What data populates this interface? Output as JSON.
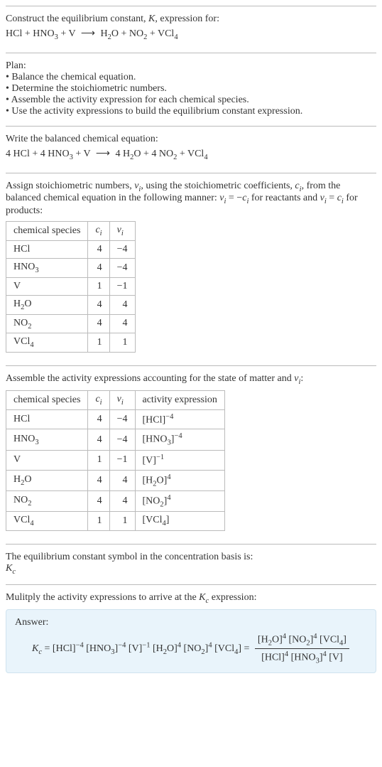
{
  "header": {
    "construct_prefix": "Construct the equilibrium constant, ",
    "K": "K",
    "construct_suffix": ", expression for:"
  },
  "unbalanced": {
    "lhs": [
      {
        "coef": "",
        "base": "HCl",
        "sub": ""
      },
      {
        "coef": "",
        "base": "HNO",
        "sub": "3"
      },
      {
        "coef": "",
        "base": "V",
        "sub": ""
      }
    ],
    "rhs": [
      {
        "coef": "",
        "base": "H",
        "sub": "2",
        "base2": "O"
      },
      {
        "coef": "",
        "base": "NO",
        "sub": "2"
      },
      {
        "coef": "",
        "base": "VCl",
        "sub": "4"
      }
    ],
    "arrow": "⟶",
    "plus": " + "
  },
  "plan": {
    "title": "Plan:",
    "items": [
      "Balance the chemical equation.",
      "Determine the stoichiometric numbers.",
      "Assemble the activity expression for each chemical species.",
      "Use the activity expressions to build the equilibrium constant expression."
    ],
    "bullet": "• "
  },
  "balanced_intro": "Write the balanced chemical equation:",
  "balanced": {
    "lhs": [
      {
        "coef": "4 ",
        "base": "HCl",
        "sub": ""
      },
      {
        "coef": "4 ",
        "base": "HNO",
        "sub": "3"
      },
      {
        "coef": "",
        "base": "V",
        "sub": ""
      }
    ],
    "rhs": [
      {
        "coef": "4 ",
        "base": "H",
        "sub": "2",
        "base2": "O"
      },
      {
        "coef": "4 ",
        "base": "NO",
        "sub": "2"
      },
      {
        "coef": "",
        "base": "VCl",
        "sub": "4"
      }
    ]
  },
  "stoich_intro": {
    "p1": "Assign stoichiometric numbers, ",
    "nu_i": "ν",
    "i": "i",
    "p2": ", using the stoichiometric coefficients, ",
    "c": "c",
    "p3": ", from the balanced chemical equation in the following manner: ",
    "eq1_l": "ν",
    "eq1_r": " = −",
    "eq1_c": "c",
    "eq1_tail": " for reactants and ",
    "eq2_l": "ν",
    "eq2_r": " = ",
    "eq2_c": "c",
    "eq2_tail": " for products:"
  },
  "table1": {
    "h1": "chemical species",
    "h2": "c",
    "h3": "ν",
    "hi": "i",
    "rows": [
      {
        "sp": "HCl",
        "sub": "",
        "c": "4",
        "nu": "−4"
      },
      {
        "sp": "HNO",
        "sub": "3",
        "c": "4",
        "nu": "−4"
      },
      {
        "sp": "V",
        "sub": "",
        "c": "1",
        "nu": "−1"
      },
      {
        "sp": "H",
        "sub": "2",
        "sp2": "O",
        "c": "4",
        "nu": "4"
      },
      {
        "sp": "NO",
        "sub": "2",
        "c": "4",
        "nu": "4"
      },
      {
        "sp": "VCl",
        "sub": "4",
        "c": "1",
        "nu": "1"
      }
    ]
  },
  "assemble_intro": {
    "p1": "Assemble the activity expressions accounting for the state of matter and ",
    "nu": "ν",
    "i": "i",
    "p2": ":"
  },
  "table2": {
    "h1": "chemical species",
    "h2": "c",
    "h3": "ν",
    "h4": "activity expression",
    "hi": "i",
    "rows": [
      {
        "sp": "HCl",
        "sub": "",
        "c": "4",
        "nu": "−4",
        "act_base": "[HCl]",
        "act_exp": "−4"
      },
      {
        "sp": "HNO",
        "sub": "3",
        "c": "4",
        "nu": "−4",
        "act_base": "[HNO",
        "act_sub": "3",
        "act_close": "]",
        "act_exp": "−4"
      },
      {
        "sp": "V",
        "sub": "",
        "c": "1",
        "nu": "−1",
        "act_base": "[V]",
        "act_exp": "−1"
      },
      {
        "sp": "H",
        "sub": "2",
        "sp2": "O",
        "c": "4",
        "nu": "4",
        "act_base": "[H",
        "act_sub": "2",
        "act_close": "O]",
        "act_exp": "4"
      },
      {
        "sp": "NO",
        "sub": "2",
        "c": "4",
        "nu": "4",
        "act_base": "[NO",
        "act_sub": "2",
        "act_close": "]",
        "act_exp": "4"
      },
      {
        "sp": "VCl",
        "sub": "4",
        "c": "1",
        "nu": "1",
        "act_base": "[VCl",
        "act_sub": "4",
        "act_close": "]",
        "act_exp": ""
      }
    ]
  },
  "kc_symbol": {
    "line1": "The equilibrium constant symbol in the concentration basis is:",
    "K": "K",
    "c": "c"
  },
  "multiply_intro": {
    "p1": "Mulitply the activity expressions to arrive at the ",
    "K": "K",
    "c": "c",
    "p2": " expression:"
  },
  "answer": {
    "label": "Answer:",
    "K": "K",
    "c": "c",
    "eq": " = ",
    "terms": [
      {
        "b": "[HCl]",
        "e": "−4"
      },
      {
        "b": "[HNO",
        "s": "3",
        "cl": "]",
        "e": "−4"
      },
      {
        "b": "[V]",
        "e": "−1"
      },
      {
        "b": "[H",
        "s": "2",
        "cl": "O]",
        "e": "4"
      },
      {
        "b": "[NO",
        "s": "2",
        "cl": "]",
        "e": "4"
      },
      {
        "b": "[VCl",
        "s": "4",
        "cl": "]",
        "e": ""
      }
    ],
    "eq2": " = ",
    "frac_num": [
      {
        "b": "[H",
        "s": "2",
        "cl": "O]",
        "e": "4"
      },
      {
        "b": "[NO",
        "s": "2",
        "cl": "]",
        "e": "4"
      },
      {
        "b": "[VCl",
        "s": "4",
        "cl": "]",
        "e": ""
      }
    ],
    "frac_den": [
      {
        "b": "[HCl]",
        "e": "4"
      },
      {
        "b": "[HNO",
        "s": "3",
        "cl": "]",
        "e": "4"
      },
      {
        "b": "[V]",
        "e": ""
      }
    ]
  }
}
